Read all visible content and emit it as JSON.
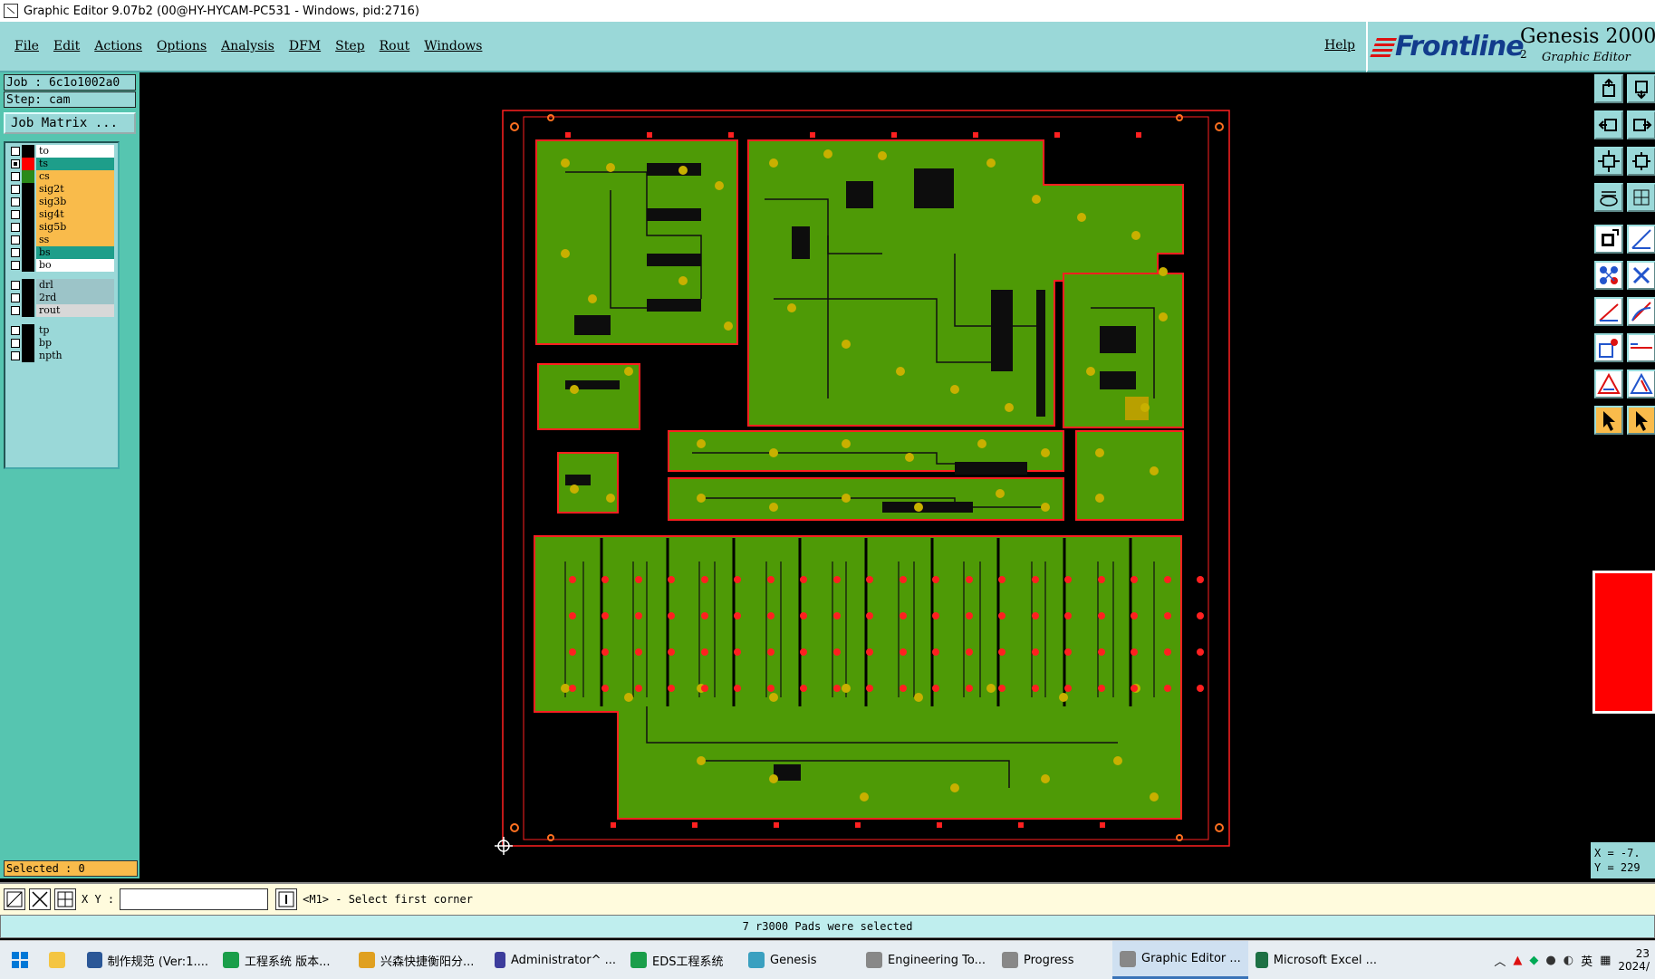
{
  "window": {
    "title": "Graphic Editor 9.07b2 (00@HY-HYCAM-PC531 - Windows, pid:2716)"
  },
  "menu": {
    "items": [
      "File",
      "Edit",
      "Actions",
      "Options",
      "Analysis",
      "DFM",
      "Step",
      "Rout",
      "Windows"
    ],
    "help": "Help"
  },
  "brand": {
    "logo": "Frontline",
    "product": "Genesis 2000",
    "product_sup": "2",
    "subtitle": "Graphic Editor"
  },
  "job": {
    "job_line": "Job : 6c1o1002a0",
    "step_line": "Step: cam",
    "matrix_button": "Job Matrix ..."
  },
  "layers": [
    {
      "name": "to",
      "color": "#ffffff",
      "swatch": "#000000",
      "checked": false
    },
    {
      "name": "ts",
      "color": "#1e9e8a",
      "swatch": "#ff0000",
      "checked": true
    },
    {
      "name": "cs",
      "color": "#f9bb4b",
      "swatch": "#2a8a1a",
      "checked": false
    },
    {
      "name": "sig2t",
      "color": "#f9bb4b",
      "swatch": "#000000",
      "checked": false
    },
    {
      "name": "sig3b",
      "color": "#f9bb4b",
      "swatch": "#000000",
      "checked": false
    },
    {
      "name": "sig4t",
      "color": "#f9bb4b",
      "swatch": "#000000",
      "checked": false
    },
    {
      "name": "sig5b",
      "color": "#f9bb4b",
      "swatch": "#000000",
      "checked": false
    },
    {
      "name": "ss",
      "color": "#f9bb4b",
      "swatch": "#000000",
      "checked": false
    },
    {
      "name": "bs",
      "color": "#1e9e8a",
      "swatch": "#000000",
      "checked": false
    },
    {
      "name": "bo",
      "color": "#ffffff",
      "swatch": "#000000",
      "checked": false
    },
    {
      "name": "drl",
      "color": "#9cc4c8",
      "swatch": "#000000",
      "checked": false
    },
    {
      "name": "2rd",
      "color": "#9cc4c8",
      "swatch": "#000000",
      "checked": false
    },
    {
      "name": "rout",
      "color": "#d8d8d8",
      "swatch": "#000000",
      "checked": false
    },
    {
      "name": "tp",
      "color": "#9ad8d8",
      "swatch": "#000000",
      "checked": false
    },
    {
      "name": "bp",
      "color": "#9ad8d8",
      "swatch": "#000000",
      "checked": false
    },
    {
      "name": "npth",
      "color": "#9ad8d8",
      "swatch": "#000000",
      "checked": false
    }
  ],
  "selected": "Selected : 0",
  "coords": {
    "x": "X = -7.",
    "y": "Y = 229"
  },
  "command": {
    "xy_label": "X Y :",
    "xy_value": "",
    "prompt": "<M1> - Select first corner"
  },
  "status": "7 r3000 Pads were selected",
  "taskbar": {
    "items": [
      {
        "label": "制作规范 (Ver:1....",
        "color": "#2b5797"
      },
      {
        "label": "工程系统   版本...",
        "color": "#1a9e4a"
      },
      {
        "label": "兴森快捷衡阳分...",
        "color": "#e0a020"
      },
      {
        "label": "Administrator^ ...",
        "color": "#3c3c9c"
      },
      {
        "label": "EDS工程系统",
        "color": "#1a9e4a"
      },
      {
        "label": "Genesis",
        "color": "#3aa0c0"
      },
      {
        "label": "Engineering To...",
        "color": "#888888"
      },
      {
        "label": "Progress",
        "color": "#888888"
      },
      {
        "label": "Graphic Editor ...",
        "color": "#888888"
      },
      {
        "label": "Microsoft Excel ...",
        "color": "#1d7044"
      }
    ],
    "ime": "英",
    "clock_time": "23",
    "clock_date": "2024/"
  },
  "colors": {
    "board_fill": "#4e9a06",
    "board_outline": "#ff2020",
    "pads": "#c8b000",
    "panel": "#56c5b0",
    "menu": "#9ad8d8"
  }
}
